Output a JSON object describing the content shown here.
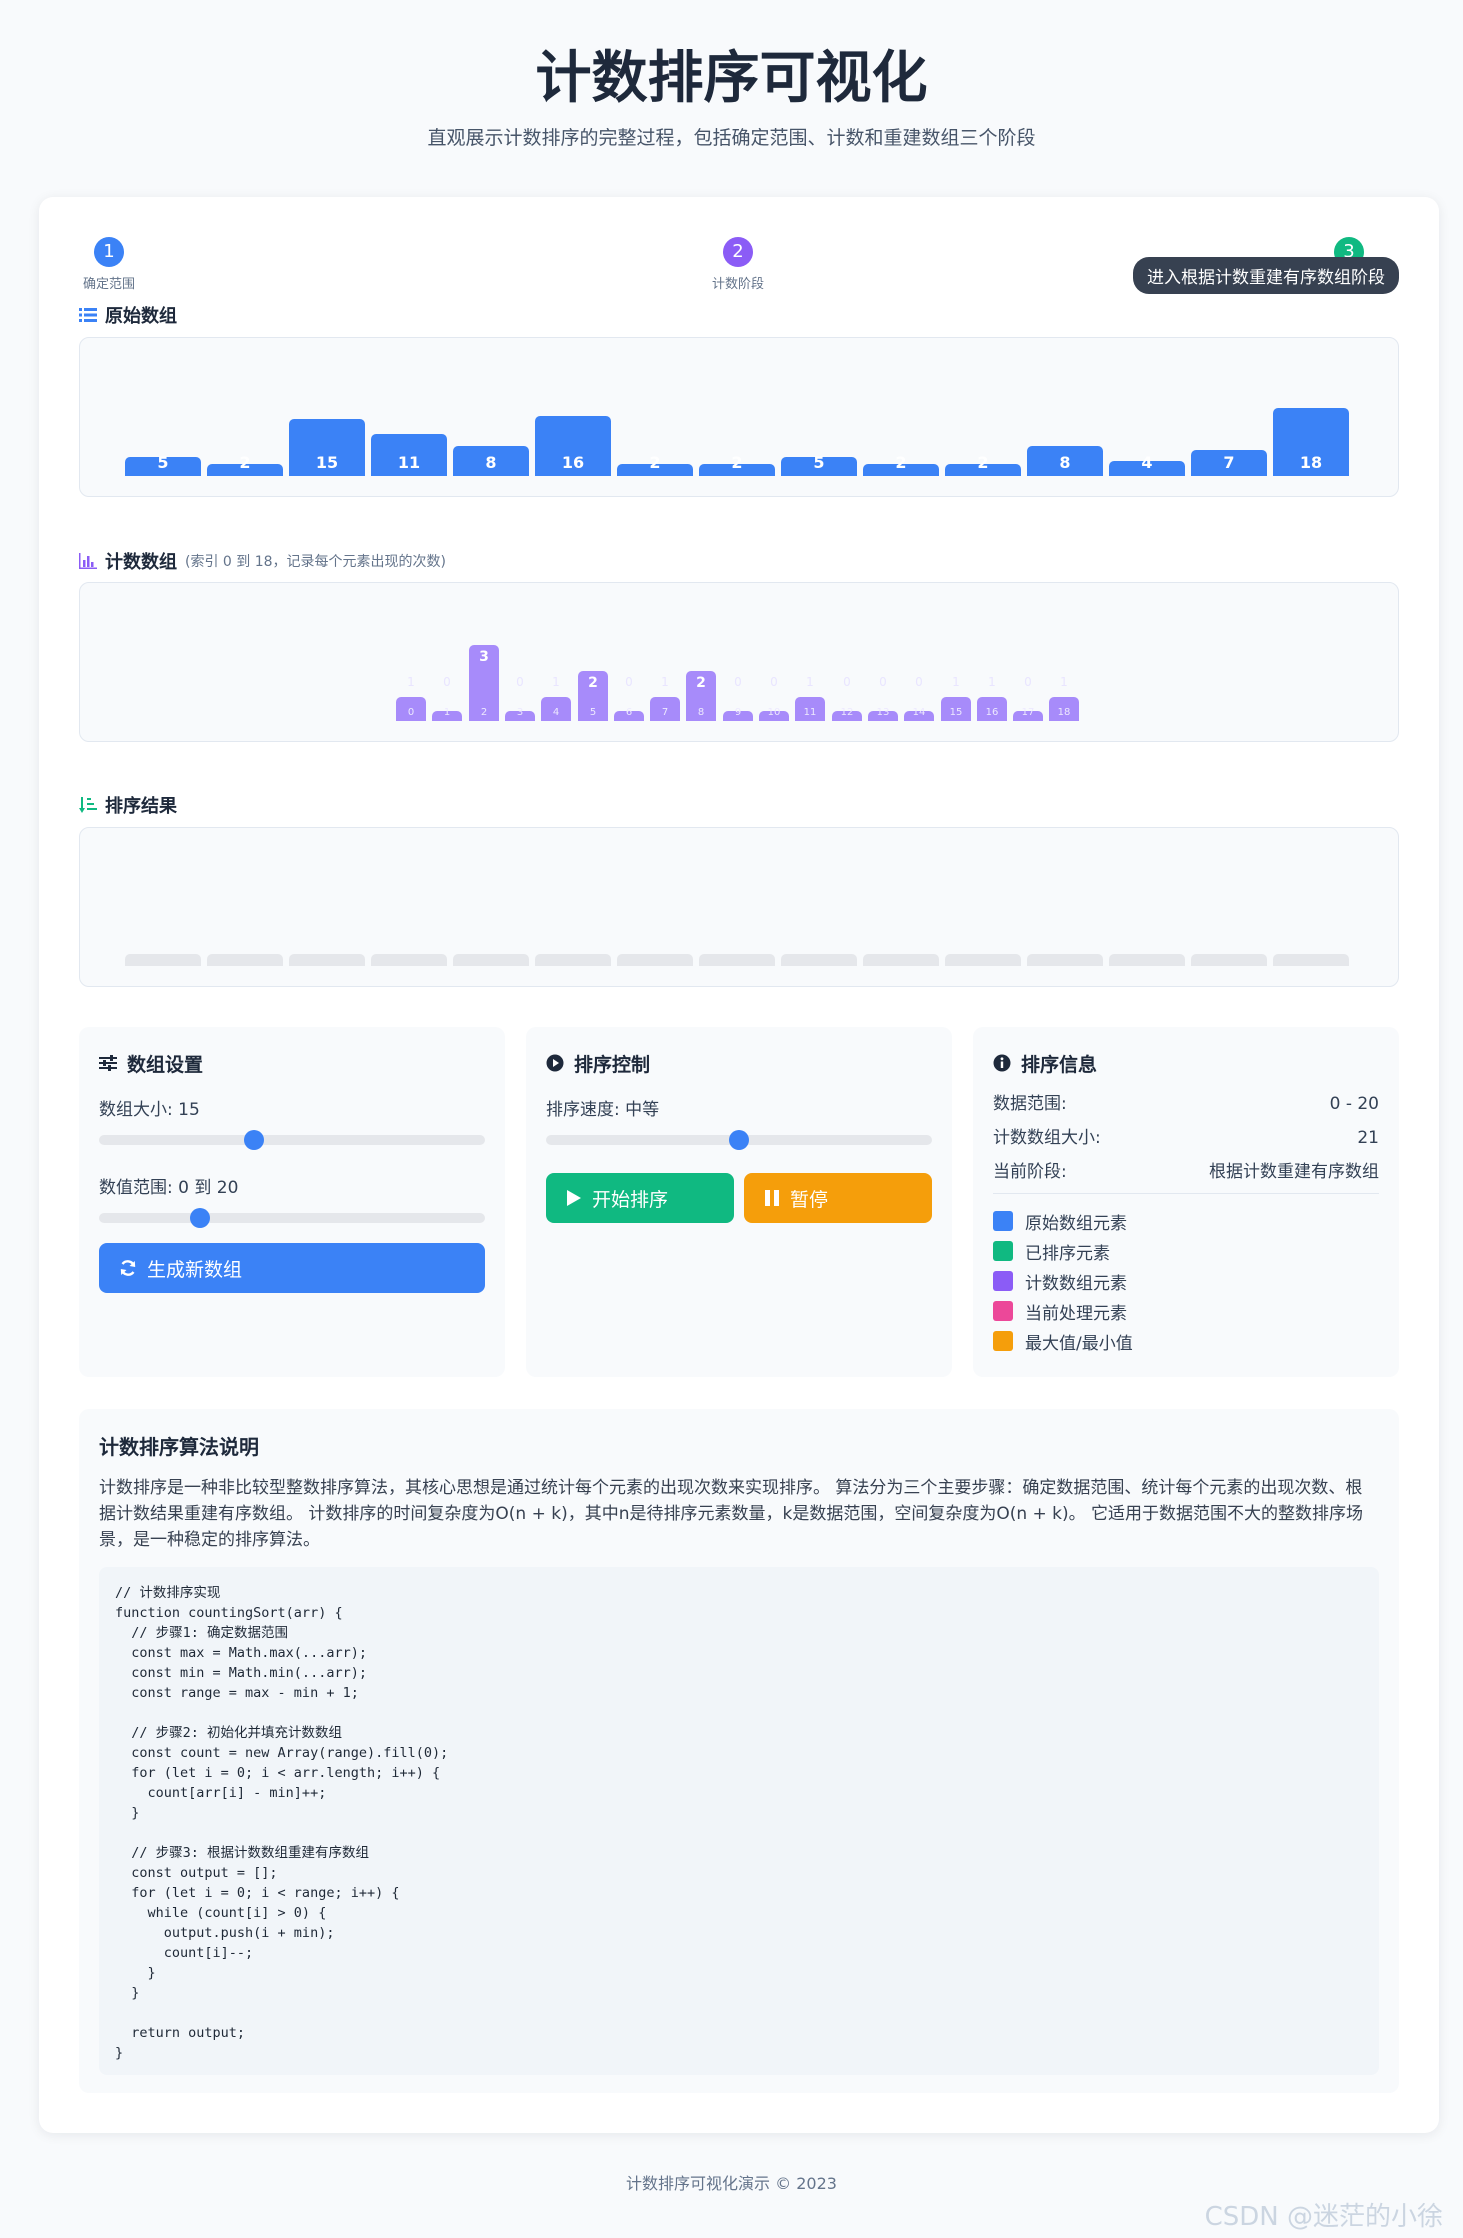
{
  "header": {
    "title": "计数排序可视化",
    "subtitle": "直观展示计数排序的完整过程，包括确定范围、计数和重建数组三个阶段"
  },
  "steps": [
    {
      "num": "1",
      "label": "确定范围",
      "color": "#3b82f6"
    },
    {
      "num": "2",
      "label": "计数阶段",
      "color": "#8b5cf6"
    },
    {
      "num": "3",
      "label": "",
      "color": "#10b981"
    }
  ],
  "step_tooltip": "进入根据计数重建有序数组阶段",
  "original": {
    "title": "原始数组",
    "values": [
      5,
      2,
      15,
      11,
      8,
      16,
      2,
      2,
      5,
      2,
      2,
      8,
      4,
      7,
      18
    ]
  },
  "counting": {
    "title": "计数数组",
    "note": "(索引 0 到 18，记录每个元素出现的次数)",
    "counts": [
      1,
      0,
      3,
      0,
      1,
      2,
      0,
      1,
      2,
      0,
      0,
      1,
      0,
      0,
      0,
      1,
      1,
      0,
      1
    ],
    "indices": [
      "0",
      "1",
      "2",
      "3",
      "4",
      "5",
      "6",
      "7",
      "8",
      "9",
      "10",
      "11",
      "12",
      "13",
      "14",
      "15",
      "16",
      "17",
      "18"
    ]
  },
  "result": {
    "title": "排序结果",
    "slots": 15
  },
  "settings": {
    "title": "数组设置",
    "size_label": "数组大小: 15",
    "size_value": 15,
    "range_label": "数值范围: 0 到 20",
    "range_value": 20,
    "generate_button": "生成新数组"
  },
  "control": {
    "title": "排序控制",
    "speed_label": "排序速度: 中等",
    "speed_level": 0.5,
    "start_button": "开始排序",
    "pause_button": "暂停"
  },
  "info": {
    "title": "排序信息",
    "rows": [
      {
        "label": "数据范围:",
        "value": "0 - 20"
      },
      {
        "label": "计数数组大小:",
        "value": "21"
      },
      {
        "label": "当前阶段:",
        "value": "根据计数重建有序数组"
      }
    ],
    "legend": [
      {
        "label": "原始数组元素",
        "color": "#3b82f6"
      },
      {
        "label": "已排序元素",
        "color": "#10b981"
      },
      {
        "label": "计数数组元素",
        "color": "#8b5cf6"
      },
      {
        "label": "当前处理元素",
        "color": "#ec4899"
      },
      {
        "label": "最大值/最小值",
        "color": "#f59e0b"
      }
    ]
  },
  "explanation": {
    "title": "计数排序算法说明",
    "text": "计数排序是一种非比较型整数排序算法，其核心思想是通过统计每个元素的出现次数来实现排序。 算法分为三个主要步骤：确定数据范围、统计每个元素的出现次数、根据计数结果重建有序数组。 计数排序的时间复杂度为O(n + k)，其中n是待排序元素数量，k是数据范围，空间复杂度为O(n + k)。 它适用于数据范围不大的整数排序场景，是一种稳定的排序算法。",
    "code": "// 计数排序实现\nfunction countingSort(arr) {\n  // 步骤1: 确定数据范围\n  const max = Math.max(...arr);\n  const min = Math.min(...arr);\n  const range = max - min + 1;\n\n  // 步骤2: 初始化并填充计数数组\n  const count = new Array(range).fill(0);\n  for (let i = 0; i < arr.length; i++) {\n    count[arr[i] - min]++;\n  }\n\n  // 步骤3: 根据计数数组重建有序数组\n  const output = [];\n  for (let i = 0; i < range; i++) {\n    while (count[i] > 0) {\n      output.push(i + min);\n      count[i]--;\n    }\n  }\n\n  return output;\n}"
  },
  "footer": "计数排序可视化演示 © 2023",
  "watermark": "CSDN @迷茫的小徐"
}
